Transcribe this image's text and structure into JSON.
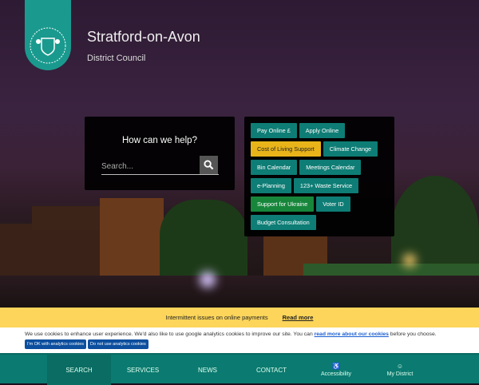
{
  "header": {
    "logo_text": "Stratford-on-Avon District Council",
    "title": "Stratford-on-Avon",
    "subtitle": "District Council"
  },
  "search": {
    "heading": "How can we help?",
    "placeholder": "Search...",
    "button_icon": "search-icon"
  },
  "quick_links": [
    [
      {
        "label": "Pay Online   £",
        "style": "teal"
      },
      {
        "label": "Apply Online",
        "style": "teal"
      }
    ],
    [
      {
        "label": "Cost of Living Support",
        "style": "yellow"
      },
      {
        "label": "Climate Change",
        "style": "teal"
      }
    ],
    [
      {
        "label": "Bin Calendar",
        "style": "teal"
      },
      {
        "label": "Meetings Calendar",
        "style": "teal"
      }
    ],
    [
      {
        "label": "e-Planning",
        "style": "teal"
      },
      {
        "label": "123+ Waste Service",
        "style": "teal"
      }
    ],
    [
      {
        "label": "Support for Ukraine",
        "style": "green"
      },
      {
        "label": "Voter ID",
        "style": "teal"
      }
    ],
    [
      {
        "label": "Budget Consultation",
        "style": "teal"
      }
    ]
  ],
  "alert": {
    "text": "Intermittent issues on online payments",
    "link": "Read more"
  },
  "cookie": {
    "text_before": "We use cookies to enhance user experience. We'd also like to use google analytics cookies to improve our site. You can ",
    "link": "read more about our cookies",
    "text_after": " before you choose.",
    "accept": "I'm OK with analytics cookies",
    "decline": "Do not use analytics cookies"
  },
  "nav": {
    "search": "SEARCH",
    "services": "SERVICES",
    "news": "NEWS",
    "contact": "CONTACT",
    "accessibility": "Accessibility",
    "my_district": "My District"
  },
  "colors": {
    "teal": "#0e7d75",
    "yellow": "#e8b419",
    "green": "#17863b",
    "alert": "#fcd55a",
    "nav": "#0b7a70"
  }
}
